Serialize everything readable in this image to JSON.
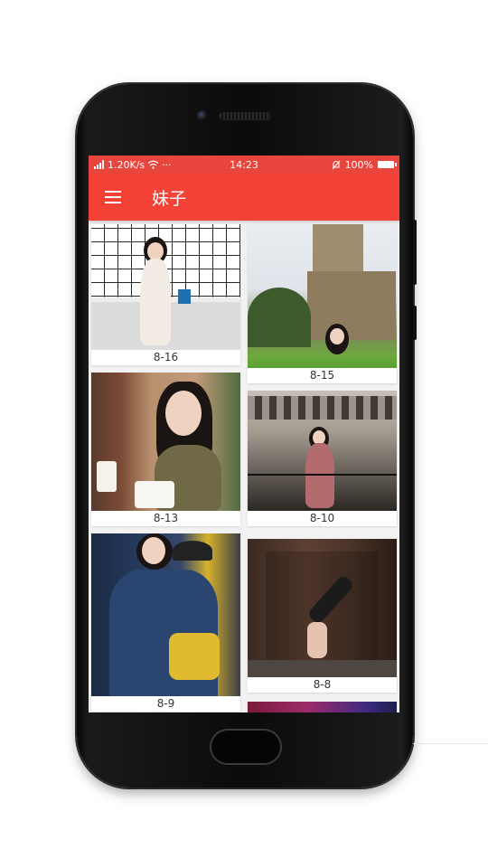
{
  "status_bar": {
    "network": "1.20K/s",
    "time": "14:23",
    "battery": "100%",
    "icons": [
      "signal-icon",
      "wifi-icon",
      "more-dots-icon",
      "alarm-off-icon",
      "battery-icon"
    ]
  },
  "app_bar": {
    "title": "妹子",
    "menu_icon": "hamburger-menu-icon",
    "color": "#f44336",
    "status_color": "#e8453c"
  },
  "gallery": {
    "items": [
      {
        "label": "8-16"
      },
      {
        "label": "8-15"
      },
      {
        "label": "8-13"
      },
      {
        "label": "8-10"
      },
      {
        "label": "8-9"
      },
      {
        "label": "8-8"
      },
      {
        "label": ""
      }
    ]
  }
}
